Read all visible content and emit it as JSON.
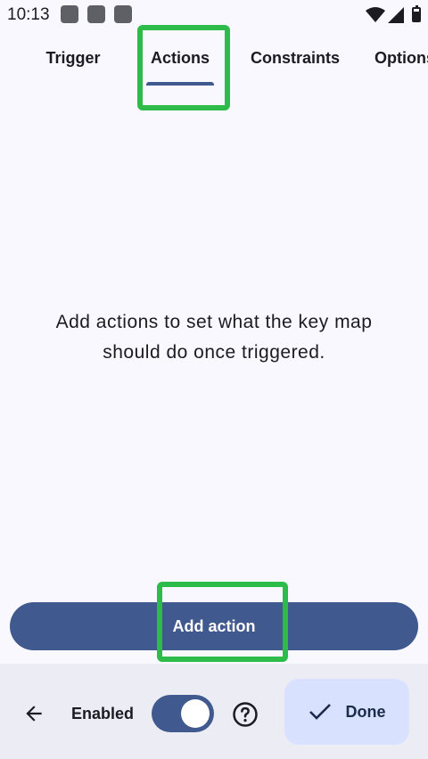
{
  "status_bar": {
    "time": "10:13",
    "icons": [
      "notification-icon",
      "notification-icon",
      "notification-icon",
      "wifi-icon",
      "signal-icon",
      "battery-icon"
    ]
  },
  "tabs": [
    {
      "label": "Trigger",
      "selected": false
    },
    {
      "label": "Actions",
      "selected": true
    },
    {
      "label": "Constraints",
      "selected": false
    },
    {
      "label": "Options",
      "selected": false
    }
  ],
  "empty_message": "Add actions to set what the key map should do once triggered.",
  "add_action_label": "Add action",
  "bottom_bar": {
    "back_icon": "arrow-back-icon",
    "enabled_label": "Enabled",
    "enabled": true,
    "help_icon": "help-icon",
    "done_label": "Done",
    "done_icon": "check-icon"
  },
  "colors": {
    "primary": "#40598e",
    "highlight": "#2dbb4a",
    "done_bg": "#d8e2ff",
    "background": "#f9f8ff",
    "bottom_bar_bg": "#ecedf4"
  }
}
